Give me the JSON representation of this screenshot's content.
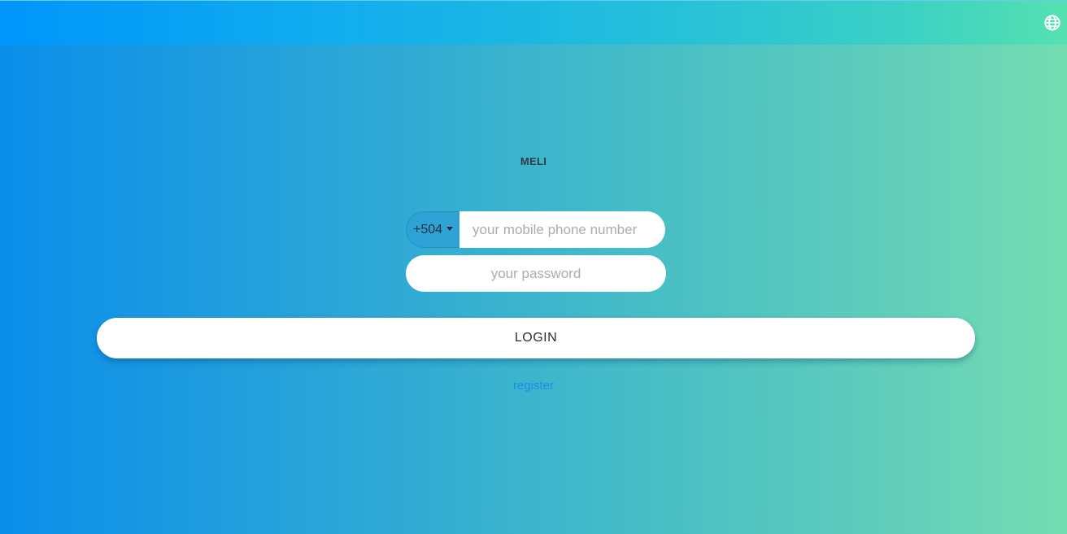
{
  "header": {
    "language_icon": "globe-icon"
  },
  "brand": {
    "name": "MELI"
  },
  "login_form": {
    "country_code": "+504",
    "phone_placeholder": "your mobile phone number",
    "phone_value": "",
    "password_placeholder": "your password",
    "password_value": "",
    "login_label": "LOGIN",
    "register_label": "register"
  },
  "colors": {
    "background_start": "#0a8eea",
    "background_end": "#74ddb2",
    "link": "#1a8fe8"
  }
}
